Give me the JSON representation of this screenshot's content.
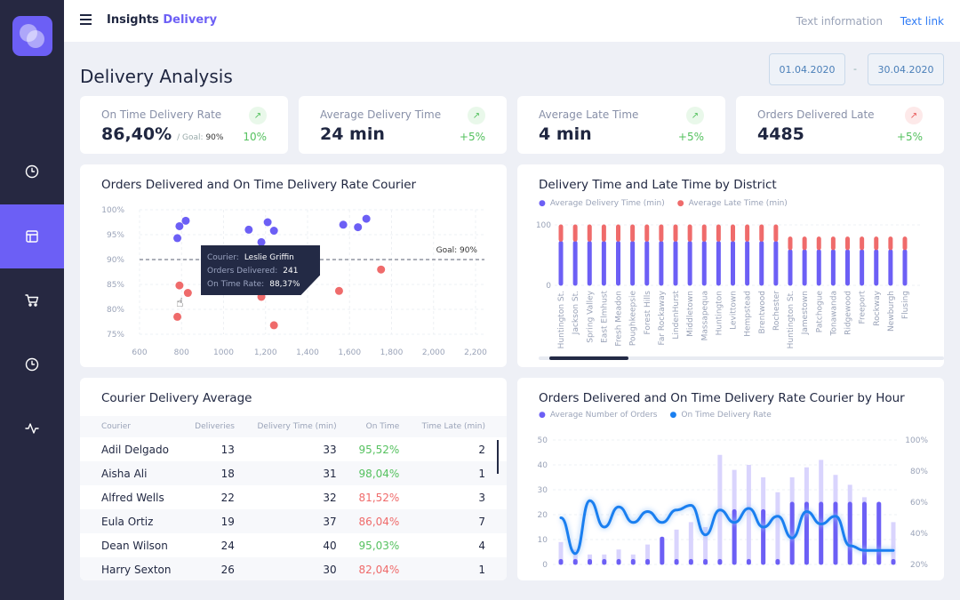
{
  "header": {
    "brand_a": "Insights",
    "brand_b": "Delivery",
    "text_info": "Text information",
    "text_link": "Text link"
  },
  "sidebar": {
    "items": [
      {
        "icon": "clock-icon"
      },
      {
        "icon": "layout-icon",
        "active": true
      },
      {
        "icon": "cart-icon"
      },
      {
        "icon": "clock-icon"
      },
      {
        "icon": "activity-icon"
      }
    ]
  },
  "page": {
    "title": "Delivery Analysis",
    "date_from": "01.04.2020",
    "date_sep": "-",
    "date_to": "30.04.2020"
  },
  "kpis": [
    {
      "label": "On Time Delivery Rate",
      "value": "86,40%",
      "goal_label": "/ Goal:",
      "goal": "90%",
      "change": "10%",
      "trend": "up",
      "color": "#55c15f"
    },
    {
      "label": "Average Delivery Time",
      "value": "24 min",
      "change": "+5%",
      "trend": "up",
      "color": "#55c15f"
    },
    {
      "label": "Average Late Time",
      "value": "4 min",
      "change": "+5%",
      "trend": "up",
      "color": "#55c15f"
    },
    {
      "label": "Orders Delivered Late",
      "value": "4485",
      "change": "+5%",
      "trend": "up-bad",
      "color": "#e85b5b"
    }
  ],
  "colors": {
    "accent": "#6c5ff5",
    "late": "#ef6b6b",
    "line": "#1a7ff0",
    "sidebar": "#262841"
  },
  "chart_data": [
    {
      "type": "scatter",
      "title": "Orders Delivered and On Time Delivery Rate Courier",
      "xlim": [
        600,
        2200
      ],
      "ylim": [
        75,
        100
      ],
      "xticks": [
        "600",
        "800",
        "1000",
        "1,200",
        "1,400",
        "1,600",
        "1,800",
        "2,000",
        "2,200"
      ],
      "xtick_values": [
        600,
        800,
        1000,
        1200,
        1400,
        1600,
        1800,
        2000,
        2200
      ],
      "yticks": [
        "100%",
        "95%",
        "90%",
        "85%",
        "80%",
        "75%"
      ],
      "ytick_values": [
        100,
        95,
        90,
        85,
        80,
        75
      ],
      "goal": 90,
      "goal_label": "Goal: 90%",
      "above": [
        [
          780,
          94.3
        ],
        [
          790,
          96.7
        ],
        [
          820,
          97.8
        ],
        [
          1120,
          96
        ],
        [
          1180,
          93.5
        ],
        [
          1210,
          97.5
        ],
        [
          1240,
          95.8
        ],
        [
          1570,
          97
        ],
        [
          1640,
          96.5
        ],
        [
          1680,
          98.2
        ]
      ],
      "below": [
        [
          790,
          84.8
        ],
        [
          830,
          83.3
        ],
        [
          780,
          78.5
        ],
        [
          1180,
          82.5
        ],
        [
          1240,
          76.8
        ],
        [
          1550,
          83.7
        ],
        [
          1750,
          88
        ]
      ],
      "tooltip": {
        "courier_label": "Courier:",
        "courier": "Leslie Griffin",
        "orders_label": "Orders Delivered:",
        "orders": "241",
        "rate_label": "On Time Rate:",
        "rate": "88,37%"
      }
    },
    {
      "type": "bar",
      "stacked": true,
      "title": "Delivery Time and Late Time by District",
      "ylim": [
        0,
        100
      ],
      "yticks": [
        "100",
        "0"
      ],
      "ytick_values": [
        100,
        0
      ],
      "categories": [
        "Huntington St.",
        "Jackson St.",
        "Spring Valley",
        "East Elmhust",
        "Fresh Meadon",
        "Poughkeepsie",
        "Forest Hills",
        "Far Rockaway",
        "LindenHurst",
        "Middletown",
        "Massapequa",
        "Huntington",
        "Levittown",
        "Hempstead",
        "Brentwood",
        "Rochester",
        "Huntington St.",
        "Jamestown",
        "Patchogue",
        "Tonawanda",
        "Ridgewood",
        "Freeport",
        "Rockway",
        "Newburgh",
        "Flusing"
      ],
      "series": [
        {
          "name": "Average Delivery Time (min)",
          "values": [
            73,
            73,
            73,
            73,
            73,
            73,
            73,
            73,
            73,
            73,
            73,
            73,
            73,
            73,
            73,
            73,
            59,
            59,
            59,
            59,
            59,
            59,
            59,
            59,
            59
          ]
        },
        {
          "name": "Average Late Time (min)",
          "values": [
            27,
            27,
            27,
            27,
            27,
            27,
            27,
            27,
            27,
            27,
            27,
            27,
            27,
            27,
            27,
            27,
            21,
            21,
            21,
            21,
            21,
            21,
            21,
            21,
            21
          ]
        }
      ]
    },
    {
      "type": "bar+line",
      "title": "Orders Delivered and On Time Delivery Rate Courier by Hour",
      "ylim": [
        0,
        50
      ],
      "y2lim": [
        20,
        100
      ],
      "yticks": [
        "50",
        "40",
        "30",
        "20",
        "10",
        "0"
      ],
      "ytick_values": [
        50,
        40,
        30,
        20,
        10,
        0
      ],
      "y2ticks": [
        "100%",
        "80%",
        "60%",
        "40%",
        "20%"
      ],
      "y2tick_values": [
        100,
        80,
        60,
        40,
        20
      ],
      "series": [
        {
          "name": "Average Number of Orders",
          "values": [
            2,
            2,
            2,
            2,
            2,
            2,
            2,
            11,
            2,
            2,
            2,
            2,
            22,
            2,
            22,
            2,
            25,
            25,
            25,
            25,
            25,
            25,
            25,
            2
          ],
          "range": [
            9,
            6,
            4,
            4,
            6,
            4,
            8,
            11,
            14,
            17,
            15,
            44,
            38,
            40,
            35,
            29,
            35,
            39,
            42,
            36,
            32,
            27,
            25,
            17
          ]
        },
        {
          "name": "On Time Delivery Rate",
          "values": [
            50,
            27,
            61,
            44,
            57,
            47,
            54,
            47,
            55,
            58,
            39,
            55,
            47,
            56,
            44,
            51,
            37,
            54,
            46,
            51,
            32,
            29,
            29,
            29
          ]
        }
      ]
    }
  ],
  "table": {
    "title": "Courier Delivery Average",
    "columns": [
      "Courier",
      "Deliveries",
      "Delivery Time (min)",
      "On Time",
      "Time Late (min)"
    ],
    "rows": [
      [
        "Adil Delgado",
        "13",
        "33",
        "95,52%",
        "2"
      ],
      [
        "Aisha Ali",
        "18",
        "31",
        "98,04%",
        "1"
      ],
      [
        "Alfred Wells",
        "22",
        "32",
        "81,52%",
        "3"
      ],
      [
        "Eula Ortiz",
        "19",
        "37",
        "86,04%",
        "7"
      ],
      [
        "Dean Wilson",
        "24",
        "40",
        "95,03%",
        "4"
      ],
      [
        "Harry Sexton",
        "26",
        "30",
        "82,04%",
        "1"
      ]
    ],
    "on_time_good": [
      "95,52%",
      "98,04%",
      "95,03%"
    ]
  }
}
